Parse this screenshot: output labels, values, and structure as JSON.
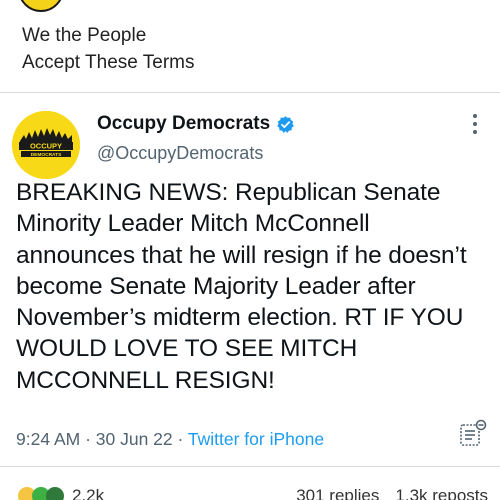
{
  "previous_tweet": {
    "line1": "We the People",
    "line2": "Accept These Terms"
  },
  "tweet": {
    "author_name": "Occupy Democrats",
    "handle": "@OccupyDemocrats",
    "avatar_text_line1": "OCCUPY",
    "avatar_text_line2": "DEMOCRATS",
    "verified": true,
    "text": "BREAKING NEWS: Republican Senate Minority Leader Mitch McConnell announces that he will resign if he doesn’t become Senate Majority Leader after November’s midterm election. RT IF YOU WOULD LOVE TO SEE MITCH MCCONNELL RESIGN!",
    "time": "9:24 AM",
    "date": "30 Jun 22",
    "separator": " · ",
    "source": "Twitter for iPhone"
  },
  "stats": {
    "reactions_count": "2.2k",
    "replies": "301 replies",
    "reposts": "1.3k reposts"
  },
  "colors": {
    "link": "#1d9bf0",
    "verified": "#1d9bf0",
    "avatar_bg": "#f7d917",
    "muted": "#536471"
  },
  "icons": [
    "verified-badge-icon",
    "more-options-icon",
    "analytics-icon",
    "reaction-icons"
  ]
}
